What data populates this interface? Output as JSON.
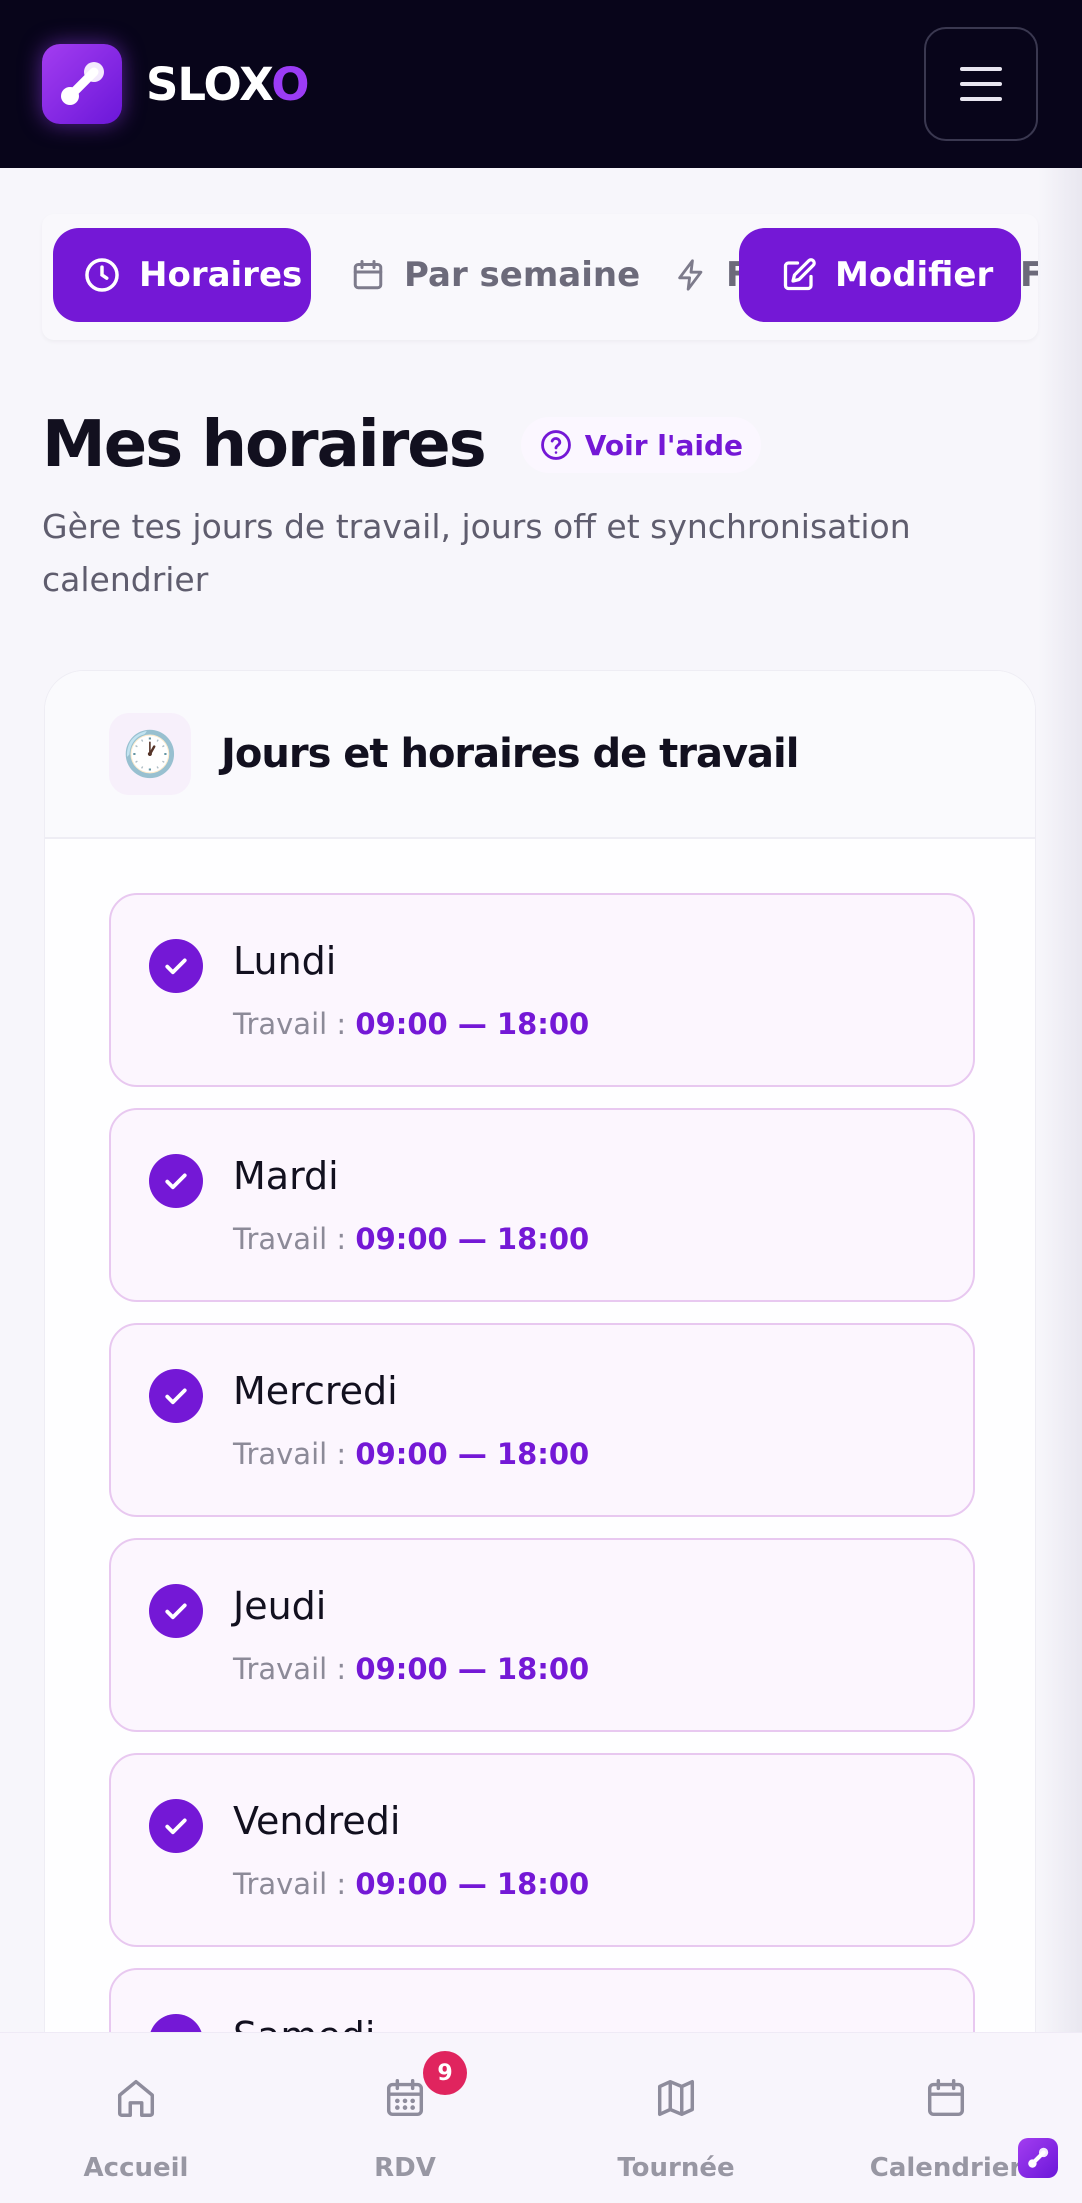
{
  "app": {
    "brand_main": "SLOX",
    "brand_accent": "O",
    "accent_color": "#7418d6"
  },
  "tabs": {
    "active": "Horaires",
    "week": "Par semaine",
    "partial": "F",
    "action": "Modifier",
    "partial_right": "Fi"
  },
  "page": {
    "title": "Mes horaires",
    "help": "Voir l'aide",
    "subtitle": "Gère tes jours de travail, jours off et synchronisation calendrier"
  },
  "card": {
    "icon": "🕐",
    "title": "Jours et horaires de travail",
    "days": [
      {
        "name": "Lundi",
        "label": "Travail :",
        "hours": "09:00 — 18:00"
      },
      {
        "name": "Mardi",
        "label": "Travail :",
        "hours": "09:00 — 18:00"
      },
      {
        "name": "Mercredi",
        "label": "Travail :",
        "hours": "09:00 — 18:00"
      },
      {
        "name": "Jeudi",
        "label": "Travail :",
        "hours": "09:00 — 18:00"
      },
      {
        "name": "Vendredi",
        "label": "Travail :",
        "hours": "09:00 — 18:00"
      },
      {
        "name": "Samedi"
      }
    ]
  },
  "nav": {
    "home": "Accueil",
    "rdv": "RDV",
    "rdv_badge": "9",
    "tour": "Tournée",
    "calendar": "Calendrier"
  }
}
